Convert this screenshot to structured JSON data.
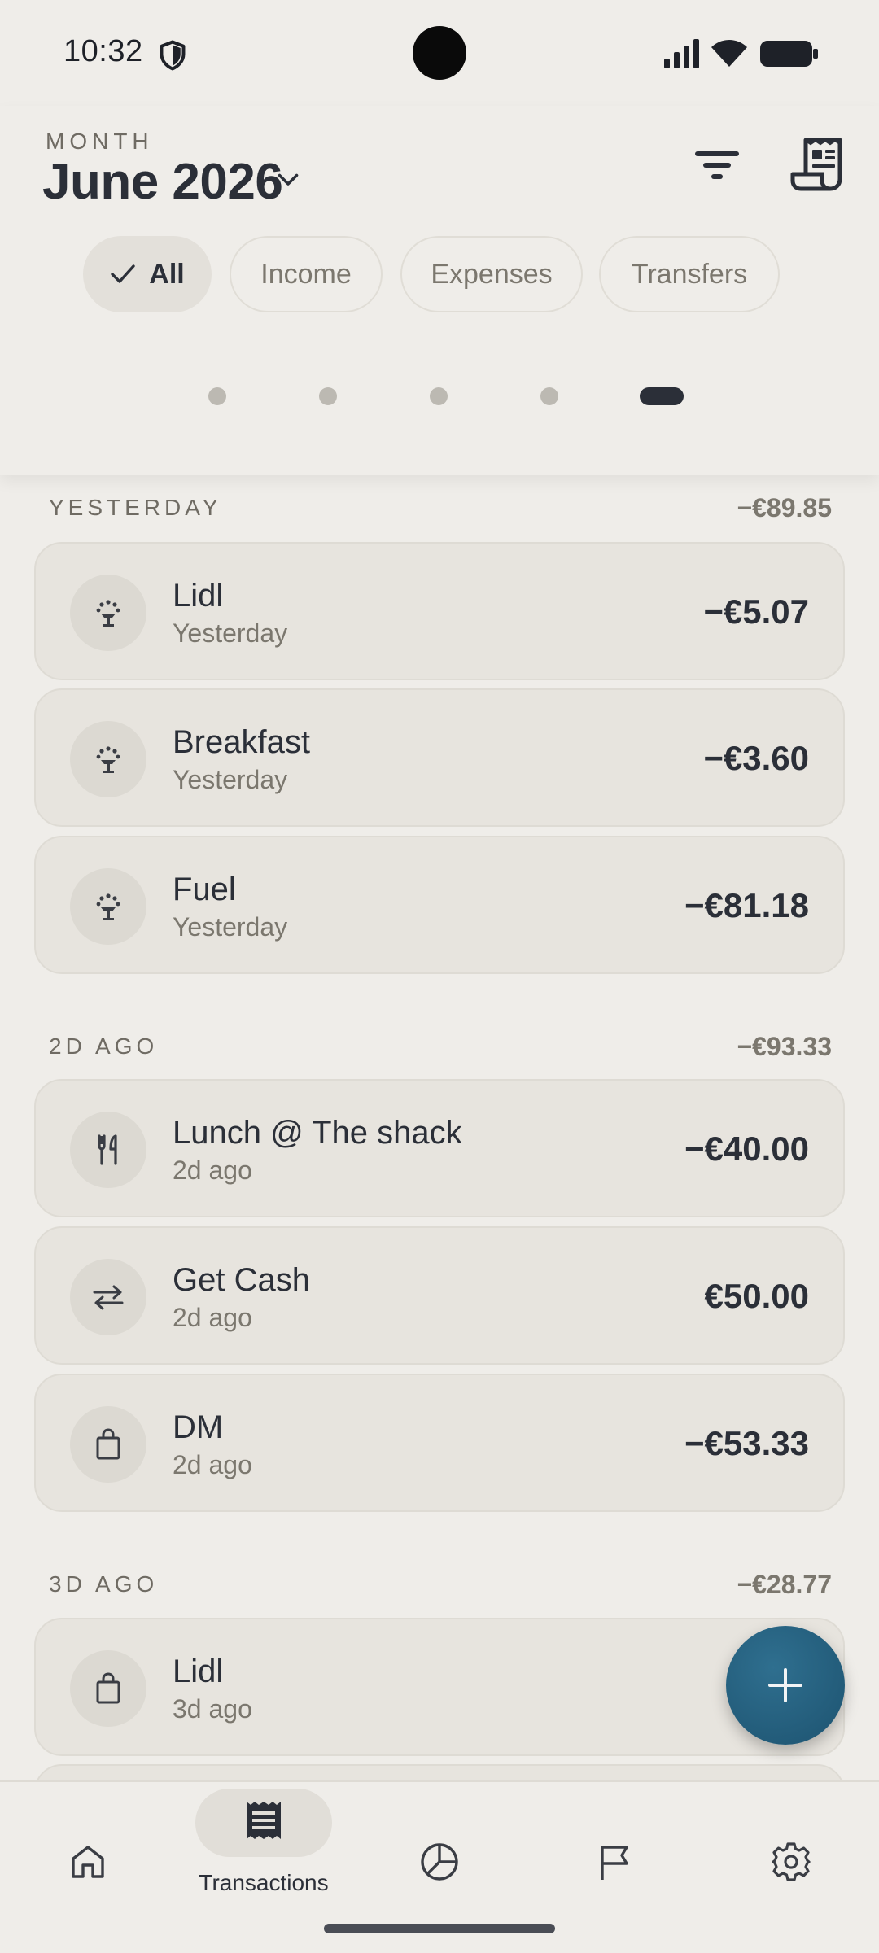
{
  "status": {
    "time": "10:32"
  },
  "header": {
    "month_label": "MONTH",
    "month_value": "June 2026",
    "filters": [
      {
        "label": "All",
        "active": true
      },
      {
        "label": "Income",
        "active": false
      },
      {
        "label": "Expenses",
        "active": false
      },
      {
        "label": "Transfers",
        "active": false
      }
    ],
    "page_dots": {
      "count": 5,
      "active_index": 5
    }
  },
  "sections": [
    {
      "title": "YESTERDAY",
      "total": "−€89.85",
      "items": [
        {
          "name": "Lidl",
          "date": "Yesterday",
          "amount": "−€5.07",
          "icon": "fountain-icon"
        },
        {
          "name": "Breakfast",
          "date": "Yesterday",
          "amount": "−€3.60",
          "icon": "fountain-icon"
        },
        {
          "name": "Fuel",
          "date": "Yesterday",
          "amount": "−€81.18",
          "icon": "fountain-icon"
        }
      ]
    },
    {
      "title": "2D AGO",
      "total": "−€93.33",
      "items": [
        {
          "name": "Lunch @ The shack",
          "date": "2d ago",
          "amount": "−€40.00",
          "icon": "fork-knife-icon"
        },
        {
          "name": "Get Cash",
          "date": "2d ago",
          "amount": "€50.00",
          "icon": "transfer-arrows-icon"
        },
        {
          "name": "DM",
          "date": "2d ago",
          "amount": "−€53.33",
          "icon": "shopping-bag-icon"
        }
      ]
    },
    {
      "title": "3D AGO",
      "total": "−€28.77",
      "items": [
        {
          "name": "Lidl",
          "date": "3d ago",
          "amount": "−€",
          "icon": "shopping-bag-icon"
        }
      ]
    }
  ],
  "bottom_nav": {
    "items": [
      {
        "icon": "home-icon",
        "label": ""
      },
      {
        "icon": "receipt-icon",
        "label": "Transactions",
        "active": true
      },
      {
        "icon": "pie-chart-icon",
        "label": ""
      },
      {
        "icon": "flag-icon",
        "label": ""
      },
      {
        "icon": "gear-icon",
        "label": ""
      }
    ]
  },
  "colors": {
    "background": "#efede9",
    "card": "#e7e4de",
    "fab": "#1d5370",
    "text": "#2b2f38",
    "muted": "#7b776e"
  }
}
